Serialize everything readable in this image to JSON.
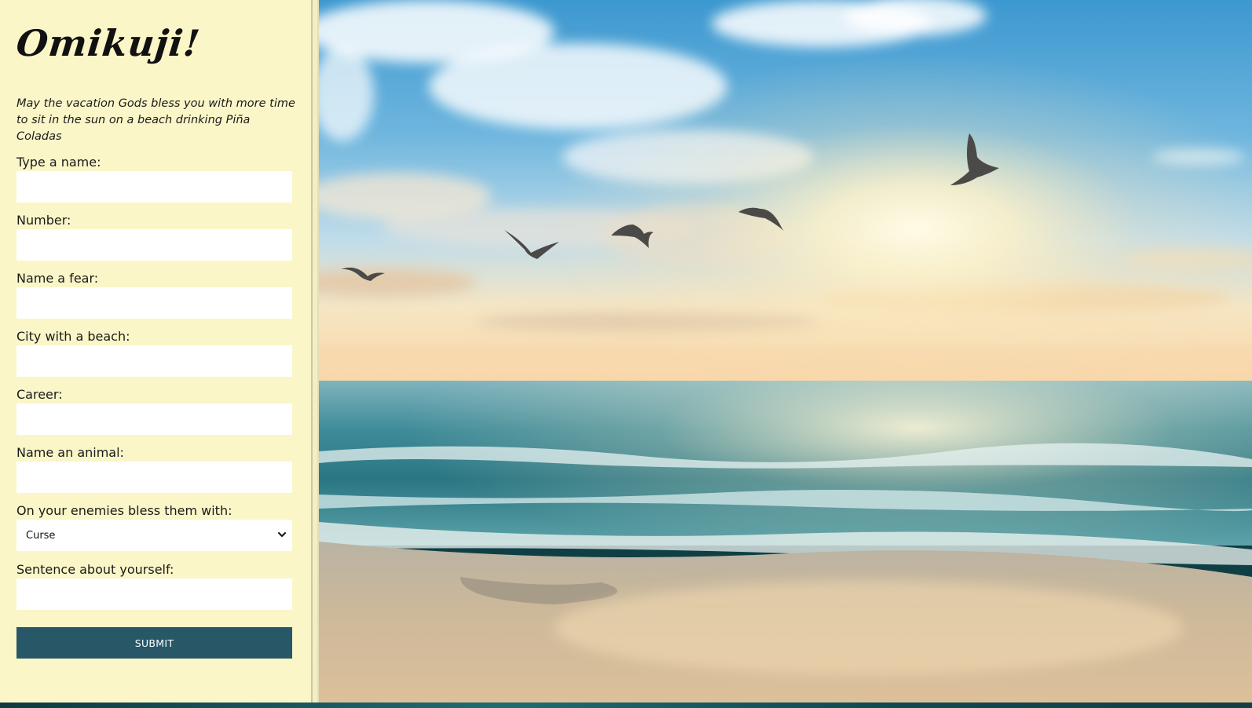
{
  "sidebar": {
    "title": "Omikuji!",
    "tagline": "May the vacation Gods bless you with more time to sit in the sun on a beach drinking Piña Coladas",
    "fields": [
      {
        "label": "Type a name:",
        "value": ""
      },
      {
        "label": "Number:",
        "value": ""
      },
      {
        "label": "Name a fear:",
        "value": ""
      },
      {
        "label": "City with a beach:",
        "value": ""
      },
      {
        "label": "Career:",
        "value": ""
      },
      {
        "label": "Name an animal:",
        "value": ""
      }
    ],
    "enemies": {
      "label": "On your enemies bless them with:",
      "selected": "Curse"
    },
    "sentence": {
      "label": "Sentence about yourself:",
      "value": ""
    },
    "submit_label": "SUBMIT"
  },
  "colors": {
    "sidebar_bg": "#faf6c8",
    "submit_bg": "#285868",
    "text": "#1a1a1a"
  },
  "icons": {
    "select_caret": "chevron-down-icon",
    "birds": "seagull-icon"
  }
}
